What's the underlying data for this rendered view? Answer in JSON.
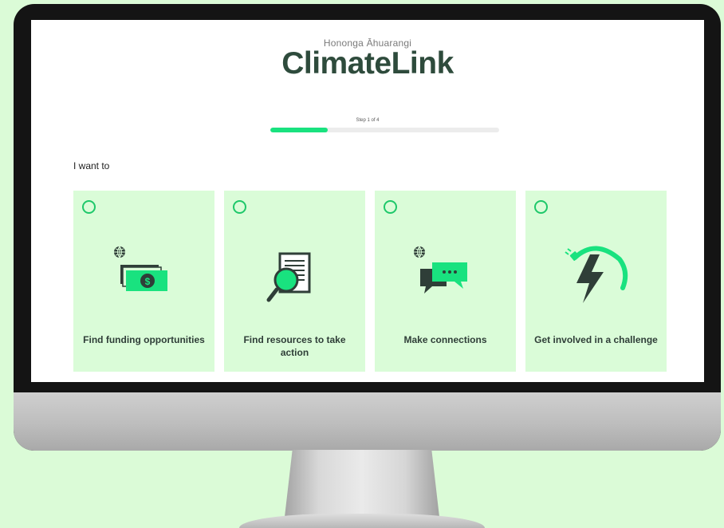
{
  "brand": {
    "subtitle": "Hononga Āhuarangi",
    "title": "ClimateLink",
    "accent_color": "#19e27f",
    "title_color": "#2e4b3c",
    "card_bg_color": "#dafcd8"
  },
  "progress": {
    "label": "Step 1 of 4",
    "fraction": 0.25
  },
  "prompt": "I want to",
  "options": [
    {
      "label": "Find funding opportunities",
      "icon": "funding-money-globe-icon",
      "selected": false
    },
    {
      "label": "Find resources to take action",
      "icon": "document-magnifier-icon",
      "selected": false
    },
    {
      "label": "Make connections",
      "icon": "chat-bubbles-globe-icon",
      "selected": false
    },
    {
      "label": "Get involved in a challenge",
      "icon": "lightning-plug-icon",
      "selected": false
    }
  ]
}
